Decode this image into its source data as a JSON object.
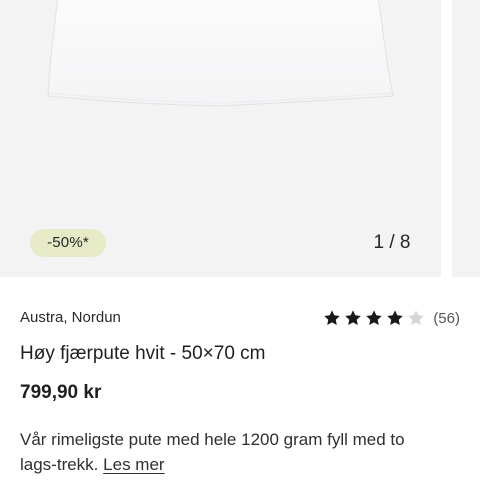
{
  "gallery": {
    "image": "pillow-image",
    "badge": "-50%*",
    "counter": "1 / 8"
  },
  "product": {
    "brand": "Austra, Nordun",
    "rating": {
      "stars": 4,
      "max_stars": 5,
      "count_label": "(56)"
    },
    "title": "Høy fjærpute hvit - 50×70 cm",
    "price": "799,90 kr",
    "description": "Vår rimeligste pute med hele 1200 gram fyll med to lags-trekk.",
    "more_link": "Les mer"
  },
  "colors": {
    "badge_bg": "#e6eac6",
    "star_filled": "#1a1a1a",
    "star_empty": "#d6d6d6",
    "image_bg": "#f3f3f3"
  }
}
